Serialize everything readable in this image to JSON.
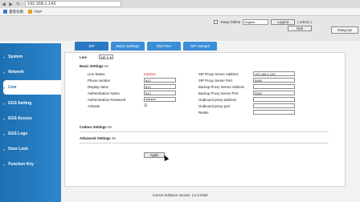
{
  "browser": {
    "url": "192.168.1.143",
    "bookmarks": [
      "書簽名稱",
      "TOIP"
    ]
  },
  "header": {
    "keep_online_label": "Keep Online",
    "language_value": "English",
    "logout_label": "Logout",
    "user_label": "( admin )",
    "dial_label": "Dial",
    "hangup_label": "Hang Up"
  },
  "sidebar": {
    "items": [
      {
        "label": "System"
      },
      {
        "label": "Network"
      },
      {
        "label": "Line"
      },
      {
        "label": "EGS Setting"
      },
      {
        "label": "EGS Access"
      },
      {
        "label": "EGS Logs"
      },
      {
        "label": "Door Lock"
      },
      {
        "label": "Function Key"
      }
    ]
  },
  "tabs": [
    {
      "label": "SIP"
    },
    {
      "label": "Basic Settings"
    },
    {
      "label": "Dial Peer"
    },
    {
      "label": "SIP Hotspot"
    }
  ],
  "form": {
    "line_label": "Line",
    "line_value": "SIP 1",
    "basic_settings_header": "Basic Settings >>",
    "line_status_label": "Line Status",
    "line_status_value": "Inactive",
    "phone_number_label": "Phone number",
    "phone_number_value": "812",
    "display_name_label": "Display name",
    "display_name_value": "812",
    "auth_name_label": "Authentication Name",
    "auth_name_value": "812",
    "auth_password_label": "Authentication Password",
    "auth_password_value": "●●●●●●",
    "activate_label": "Activate",
    "activate_checked": "☑",
    "sip_proxy_address_label": "SIP Proxy Server Address",
    "sip_proxy_address_value": "192.168.1.100",
    "sip_proxy_port_label": "SIP Proxy Server Port",
    "sip_proxy_port_value": "5060",
    "backup_proxy_address_label": "Backup Proxy Server Address",
    "backup_proxy_address_value": "",
    "backup_proxy_port_label": "Backup Proxy Server Port",
    "backup_proxy_port_value": "5060",
    "outbound_proxy_address_label": "Outbound proxy address",
    "outbound_proxy_address_value": "",
    "outbound_proxy_port_label": "Outbound proxy port",
    "outbound_proxy_port_value": "",
    "realm_label": "Realm",
    "realm_value": "",
    "codecs_settings_header": "Codecs Settings >>",
    "advanced_settings_header": "Advanced Settings >>",
    "apply_label": "Apply"
  },
  "footer": {
    "version_text": "Current Software Version: 2.4.0.8403"
  },
  "colors": {
    "sidebar": "#2d86cc",
    "tab": "#3b8fd6",
    "status": "#cc2222"
  }
}
